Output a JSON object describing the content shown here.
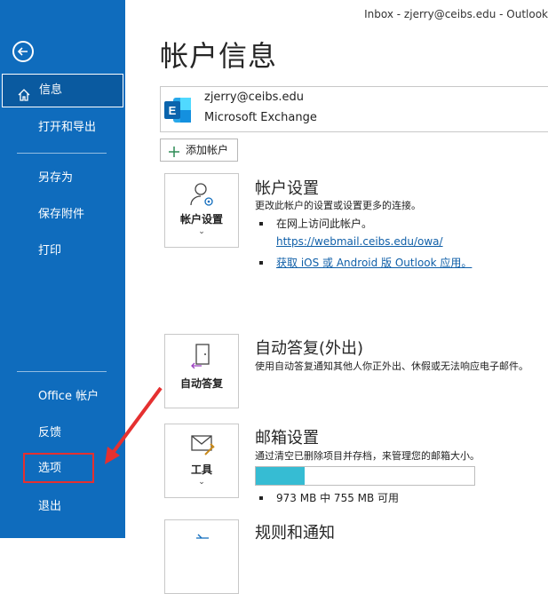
{
  "window": {
    "title": "Inbox - zjerry@ceibs.edu - Outlook"
  },
  "sidebar": {
    "items": [
      {
        "label": "信息"
      },
      {
        "label": "打开和导出"
      },
      {
        "label": "另存为"
      },
      {
        "label": "保存附件"
      },
      {
        "label": "打印"
      },
      {
        "label": "Office 帐户"
      },
      {
        "label": "反馈"
      },
      {
        "label": "选项"
      },
      {
        "label": "退出"
      }
    ]
  },
  "main": {
    "title": "帐户信息",
    "account": {
      "email": "zjerry@ceibs.edu",
      "type": "Microsoft Exchange"
    },
    "add_account_label": "添加帐户",
    "sections": [
      {
        "tile_label": "帐户设置",
        "title": "帐户设置",
        "description": "更改此帐户的设置或设置更多的连接。",
        "bullet1": "在网上访问此帐户。",
        "link1": "https://webmail.ceibs.edu/owa/",
        "link2": "获取 iOS 或 Android 版 Outlook 应用。"
      },
      {
        "tile_label": "自动答复",
        "title": "自动答复(外出)",
        "description": "使用自动答复通知其他人你正外出、休假或无法响应电子邮件。"
      },
      {
        "tile_label": "工具",
        "title": "邮箱设置",
        "description": "通过清空已删除项目并存档，来管理您的邮箱大小。",
        "storage_text": "973 MB 中 755 MB 可用",
        "used_fraction": 0.224
      },
      {
        "title": "规则和通知"
      }
    ]
  },
  "colors": {
    "sidebar": "#0f6cbd",
    "highlight": "#e53030",
    "progress": "#36bcd3",
    "link": "#0f5fa8"
  }
}
